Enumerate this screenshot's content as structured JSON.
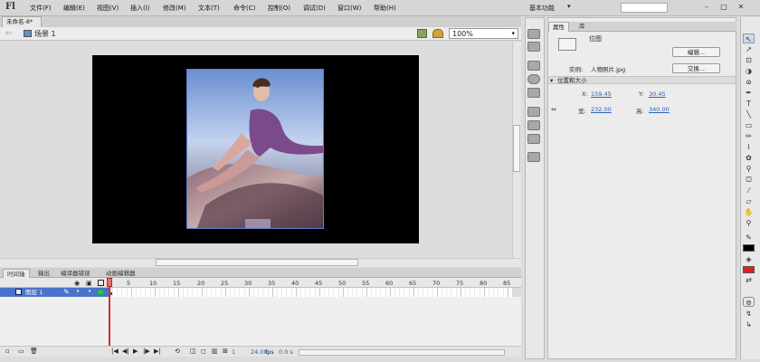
{
  "app": {
    "logo": "Fl"
  },
  "menu": [
    "文件(F)",
    "编辑(E)",
    "视图(V)",
    "插入(I)",
    "修改(M)",
    "文本(T)",
    "命令(C)",
    "控制(O)",
    "调试(D)",
    "窗口(W)",
    "帮助(H)"
  ],
  "workspace": {
    "label": "基本功能"
  },
  "window_controls": {
    "minimize": "–",
    "maximize": "□",
    "close": "✕"
  },
  "document": {
    "tab": "未命名-8*"
  },
  "scenebar": {
    "scene": "场景 1",
    "zoom": "100%"
  },
  "timeline": {
    "tabs": [
      "时间轴",
      "输出",
      "编译器错误",
      "动画编辑器"
    ],
    "layer": "图层 1",
    "ruler": [
      "1",
      "5",
      "10",
      "15",
      "20",
      "25",
      "30",
      "35",
      "40",
      "45",
      "50",
      "55",
      "60",
      "65",
      "70",
      "75",
      "80",
      "85"
    ],
    "current_frame": "1",
    "fps": "24.00",
    "fps_unit": "fps",
    "time": "0.0 s"
  },
  "properties": {
    "tabs": [
      "属性",
      "库"
    ],
    "type": "位图",
    "edit_button": "编辑...",
    "swap_button": "交换...",
    "instance_label": "实例:",
    "instance_value": "人物照片.jpg",
    "section": "位置和大小",
    "x_label": "X:",
    "x": "159.45",
    "y_label": "Y:",
    "y": "30.45",
    "w_label": "宽:",
    "w": "232.00",
    "h_label": "高:",
    "h": "340.00"
  },
  "colors": {
    "stroke": "#000000",
    "fill": "#e11d1d",
    "playhead": "#d62b2b",
    "layer_selected": "#4a74c9"
  }
}
